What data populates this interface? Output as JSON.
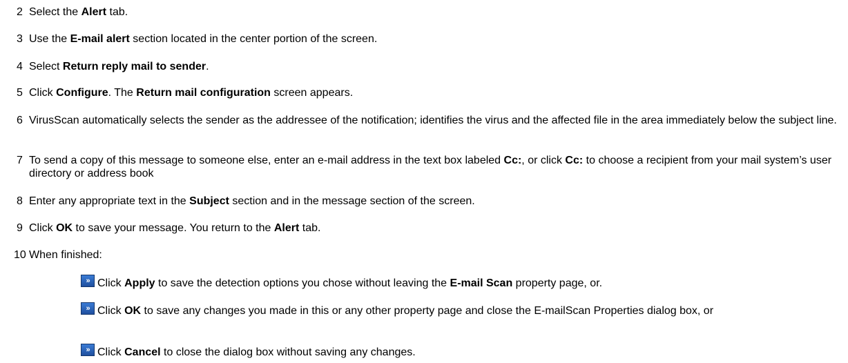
{
  "steps": [
    {
      "num": "2",
      "parts": [
        {
          "t": "Select the "
        },
        {
          "t": "Alert",
          "b": true
        },
        {
          "t": " tab."
        }
      ]
    },
    {
      "num": "3",
      "parts": [
        {
          "t": "Use the "
        },
        {
          "t": "E-mail alert",
          "b": true
        },
        {
          "t": " section located in the center portion of the screen."
        }
      ]
    },
    {
      "num": "4",
      "parts": [
        {
          "t": "Select "
        },
        {
          "t": "Return reply mail to sender",
          "b": true
        },
        {
          "t": "."
        }
      ]
    },
    {
      "num": "5",
      "parts": [
        {
          "t": "Click "
        },
        {
          "t": "Configure",
          "b": true
        },
        {
          "t": ". The "
        },
        {
          "t": "Return mail configuration",
          "b": true
        },
        {
          "t": " screen appears."
        }
      ]
    },
    {
      "num": "6",
      "parts": [
        {
          "t": "VirusScan automatically selects the sender as the addressee of the notification; identifies the virus and the affected file in the area immediately below the subject line."
        }
      ]
    },
    {
      "num": "7",
      "parts": [
        {
          "t": "To send a copy of this message to someone else, enter an e-mail address in the text box labeled "
        },
        {
          "t": "Cc:",
          "b": true
        },
        {
          "t": ", or click "
        },
        {
          "t": "Cc:",
          "b": true
        },
        {
          "t": " to choose a recipient from your mail system’s user directory or address book"
        }
      ]
    },
    {
      "num": "8",
      "parts": [
        {
          "t": "Enter any appropriate text in the "
        },
        {
          "t": "Subject",
          "b": true
        },
        {
          "t": " section and in the message section of the screen."
        }
      ]
    },
    {
      "num": "9",
      "parts": [
        {
          "t": "Click "
        },
        {
          "t": "OK",
          "b": true
        },
        {
          "t": " to save your message. You return to the "
        },
        {
          "t": "Alert",
          "b": true
        },
        {
          "t": " tab."
        }
      ]
    },
    {
      "num": "10",
      "parts": [
        {
          "t": "When finished:"
        }
      ]
    }
  ],
  "substeps": [
    {
      "icon": "next-arrow-icon",
      "icon_text": "»",
      "parts": [
        {
          "t": "Click "
        },
        {
          "t": "Apply",
          "b": true
        },
        {
          "t": " to save the detection options you chose without leaving the "
        },
        {
          "t": "E-mail Scan",
          "b": true
        },
        {
          "t": " property page, or."
        }
      ]
    },
    {
      "icon": "next-arrow-icon",
      "icon_text": "»",
      "parts": [
        {
          "t": "Click "
        },
        {
          "t": "OK",
          "b": true
        },
        {
          "t": " to save any changes you made in this or any other property page and close the E-mailScan Properties dialog box, or"
        }
      ]
    },
    {
      "icon": "next-arrow-icon",
      "icon_text": "»",
      "parts": [
        {
          "t": "Click "
        },
        {
          "t": "Cancel",
          "b": true
        },
        {
          "t": " to close the dialog box without saving any changes."
        }
      ]
    }
  ]
}
